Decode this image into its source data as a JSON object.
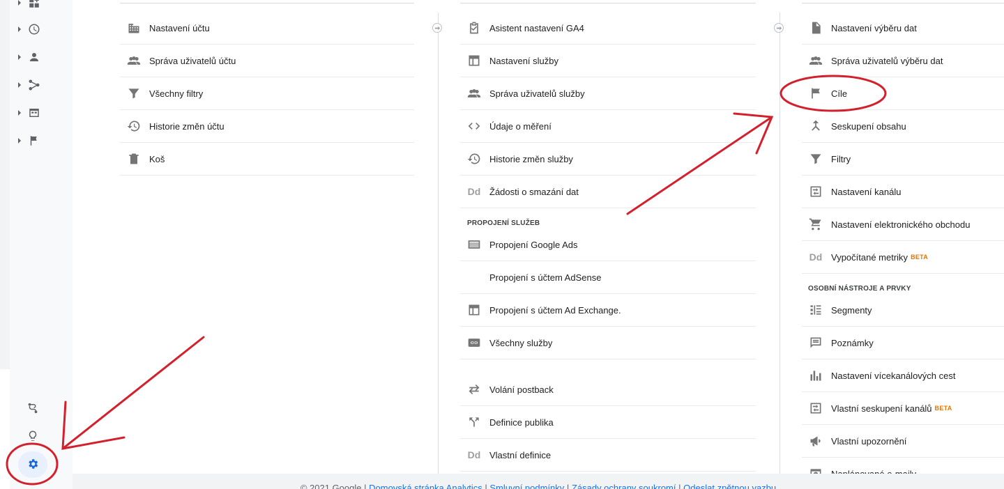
{
  "rail": {
    "nav_icons": [
      "customization-icon",
      "realtime-clock-icon",
      "audience-person-icon",
      "acquisition-icon",
      "behavior-icon",
      "conversions-flag-icon"
    ],
    "bottom_icons": [
      "attribution-icon",
      "discover-lightbulb-icon",
      "admin-gear-icon"
    ]
  },
  "account_column": {
    "items": [
      {
        "label": "Nastavení účtu",
        "icon": "building-icon"
      },
      {
        "label": "Správa uživatelů účtu",
        "icon": "people-icon"
      },
      {
        "label": "Všechny filtry",
        "icon": "filter-icon"
      },
      {
        "label": "Historie změn účtu",
        "icon": "history-icon"
      },
      {
        "label": "Koš",
        "icon": "trash-icon"
      }
    ]
  },
  "property_column": {
    "items": [
      {
        "label": "Asistent nastavení GA4",
        "icon": "clipboard-check-icon"
      },
      {
        "label": "Nastavení služby",
        "icon": "layout-icon"
      },
      {
        "label": "Správa uživatelů služby",
        "icon": "people-icon"
      },
      {
        "label": "Údaje o měření",
        "icon": "code-icon"
      },
      {
        "label": "Historie změn služby",
        "icon": "history-icon"
      },
      {
        "label": "Žádosti o smazání dat",
        "icon": "dd-icon",
        "icon_text": "Dd"
      }
    ],
    "section_title": "PROPOJENÍ SLUŽEB",
    "link_items": [
      {
        "label": "Propojení Google Ads",
        "icon": "ads-list-icon"
      },
      {
        "label": "Propojení s účtem AdSense",
        "icon": "none"
      },
      {
        "label": "Propojení s účtem Ad Exchange.",
        "icon": "layout-icon"
      },
      {
        "label": "Všechny služby",
        "icon": "link-icon"
      }
    ],
    "other_items": [
      {
        "label": "Volání postback",
        "icon": "postback-icon"
      },
      {
        "label": "Definice publika",
        "icon": "audience-fork-icon"
      },
      {
        "label": "Vlastní definice",
        "icon": "dd-icon",
        "icon_text": "Dd"
      }
    ]
  },
  "view_column": {
    "items": [
      {
        "label": "Nastavení výběru dat",
        "icon": "document-icon"
      },
      {
        "label": "Správa uživatelů výběru dat",
        "icon": "people-icon"
      },
      {
        "label": "Cíle",
        "icon": "flag-icon"
      },
      {
        "label": "Seskupení obsahu",
        "icon": "merge-icon"
      },
      {
        "label": "Filtry",
        "icon": "filter-icon"
      },
      {
        "label": "Nastavení kanálu",
        "icon": "channel-icon"
      },
      {
        "label": "Nastavení elektronického obchodu",
        "icon": "cart-icon"
      },
      {
        "label": "Vypočítané metriky",
        "icon": "dd-icon",
        "icon_text": "Dd",
        "badge": "BETA"
      }
    ],
    "section_title": "OSOBNÍ NÁSTROJE A PRVKY",
    "tool_items": [
      {
        "label": "Segmenty",
        "icon": "segments-icon"
      },
      {
        "label": "Poznámky",
        "icon": "annotation-icon"
      },
      {
        "label": "Nastavení vícekanálových cest",
        "icon": "bar-chart-icon"
      },
      {
        "label": "Vlastní seskupení kanálů",
        "icon": "channel-icon",
        "badge": "BETA"
      },
      {
        "label": "Vlastní upozornění",
        "icon": "megaphone-icon"
      },
      {
        "label": "Naplánované e-maily",
        "icon": "schedule-icon"
      }
    ]
  },
  "footer": {
    "copyright": "© 2021 Google",
    "sep": "|",
    "links": [
      "Domovská stránka Analytics",
      "Smluvní podmínky",
      "Zásady ochrany soukromí",
      "Odeslat zpětnou vazbu"
    ]
  },
  "annotation_colors": {
    "red": "#d3202d"
  }
}
